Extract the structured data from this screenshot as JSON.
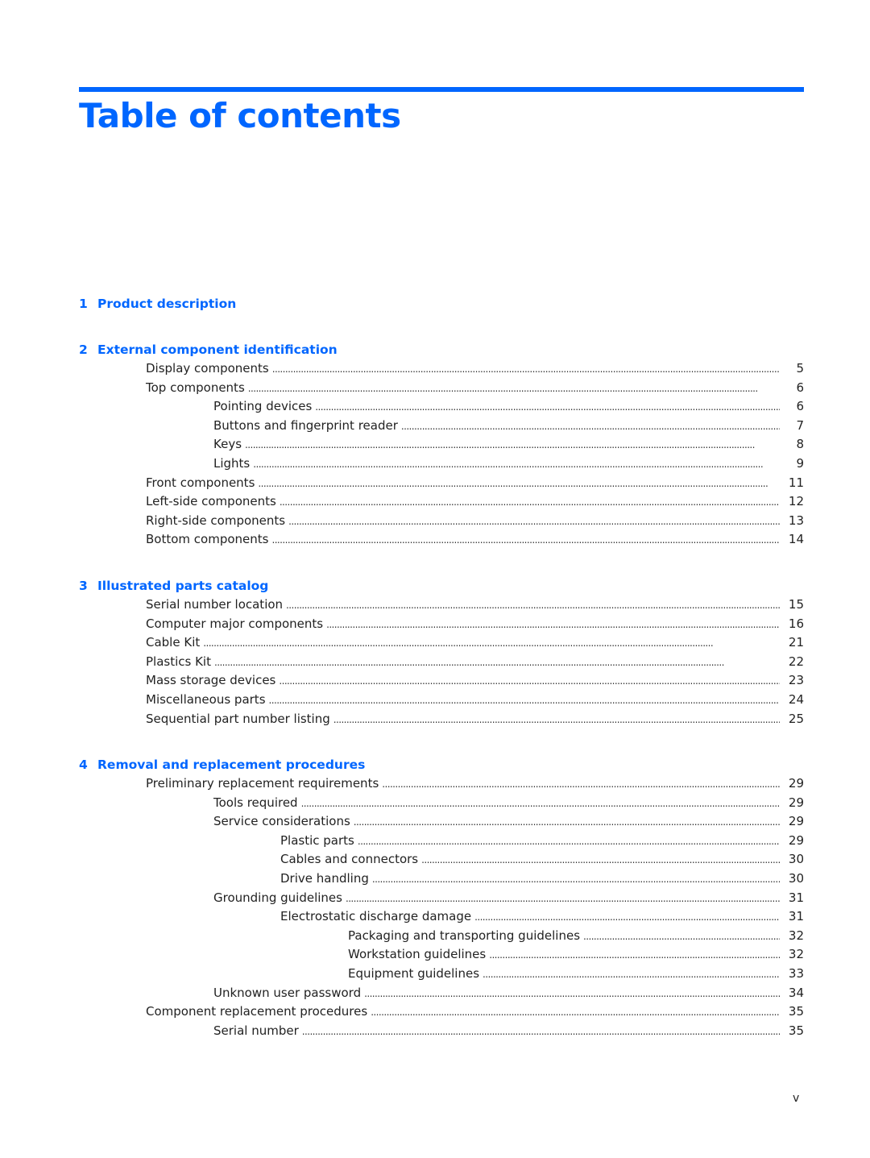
{
  "header": {
    "title": "Table of contents",
    "accent_color": "#0066ff"
  },
  "chapters": [
    {
      "number": "1",
      "title": "Product description",
      "entries": []
    },
    {
      "number": "2",
      "title": "External component identification",
      "entries": [
        {
          "level": 1,
          "label": "Display components",
          "page": "5"
        },
        {
          "level": 1,
          "label": "Top components",
          "page": "6"
        },
        {
          "level": 2,
          "label": "Pointing devices",
          "page": "6"
        },
        {
          "level": 2,
          "label": "Buttons and fingerprint reader",
          "page": "7"
        },
        {
          "level": 2,
          "label": "Keys",
          "page": "8"
        },
        {
          "level": 2,
          "label": "Lights",
          "page": "9"
        },
        {
          "level": 1,
          "label": "Front components",
          "page": "11"
        },
        {
          "level": 1,
          "label": "Left-side components",
          "page": "12"
        },
        {
          "level": 1,
          "label": "Right-side components",
          "page": "13"
        },
        {
          "level": 1,
          "label": "Bottom components",
          "page": "14"
        }
      ]
    },
    {
      "number": "3",
      "title": "Illustrated parts catalog",
      "entries": [
        {
          "level": 1,
          "label": "Serial number location",
          "page": "15"
        },
        {
          "level": 1,
          "label": "Computer major components",
          "page": "16"
        },
        {
          "level": 1,
          "label": "Cable Kit",
          "page": "21"
        },
        {
          "level": 1,
          "label": "Plastics Kit",
          "page": "22"
        },
        {
          "level": 1,
          "label": "Mass storage devices",
          "page": "23"
        },
        {
          "level": 1,
          "label": "Miscellaneous parts",
          "page": "24"
        },
        {
          "level": 1,
          "label": "Sequential part number listing",
          "page": "25"
        }
      ]
    },
    {
      "number": "4",
      "title": "Removal and replacement procedures",
      "entries": [
        {
          "level": 1,
          "label": "Preliminary replacement requirements",
          "page": "29"
        },
        {
          "level": 2,
          "label": "Tools required",
          "page": "29"
        },
        {
          "level": 2,
          "label": "Service considerations",
          "page": "29"
        },
        {
          "level": 3,
          "label": "Plastic parts",
          "page": "29"
        },
        {
          "level": 3,
          "label": "Cables and connectors",
          "page": "30"
        },
        {
          "level": 3,
          "label": "Drive handling",
          "page": "30"
        },
        {
          "level": 2,
          "label": "Grounding guidelines",
          "page": "31"
        },
        {
          "level": 3,
          "label": "Electrostatic discharge damage",
          "page": "31"
        },
        {
          "level": 4,
          "label": "Packaging and transporting guidelines",
          "page": "32"
        },
        {
          "level": 4,
          "label": "Workstation guidelines",
          "page": "32"
        },
        {
          "level": 4,
          "label": "Equipment guidelines",
          "page": "33"
        },
        {
          "level": 2,
          "label": "Unknown user password",
          "page": "34"
        },
        {
          "level": 1,
          "label": "Component replacement procedures",
          "page": "35"
        },
        {
          "level": 2,
          "label": "Serial number",
          "page": "35"
        }
      ]
    }
  ],
  "footer": {
    "page_number": "v"
  }
}
